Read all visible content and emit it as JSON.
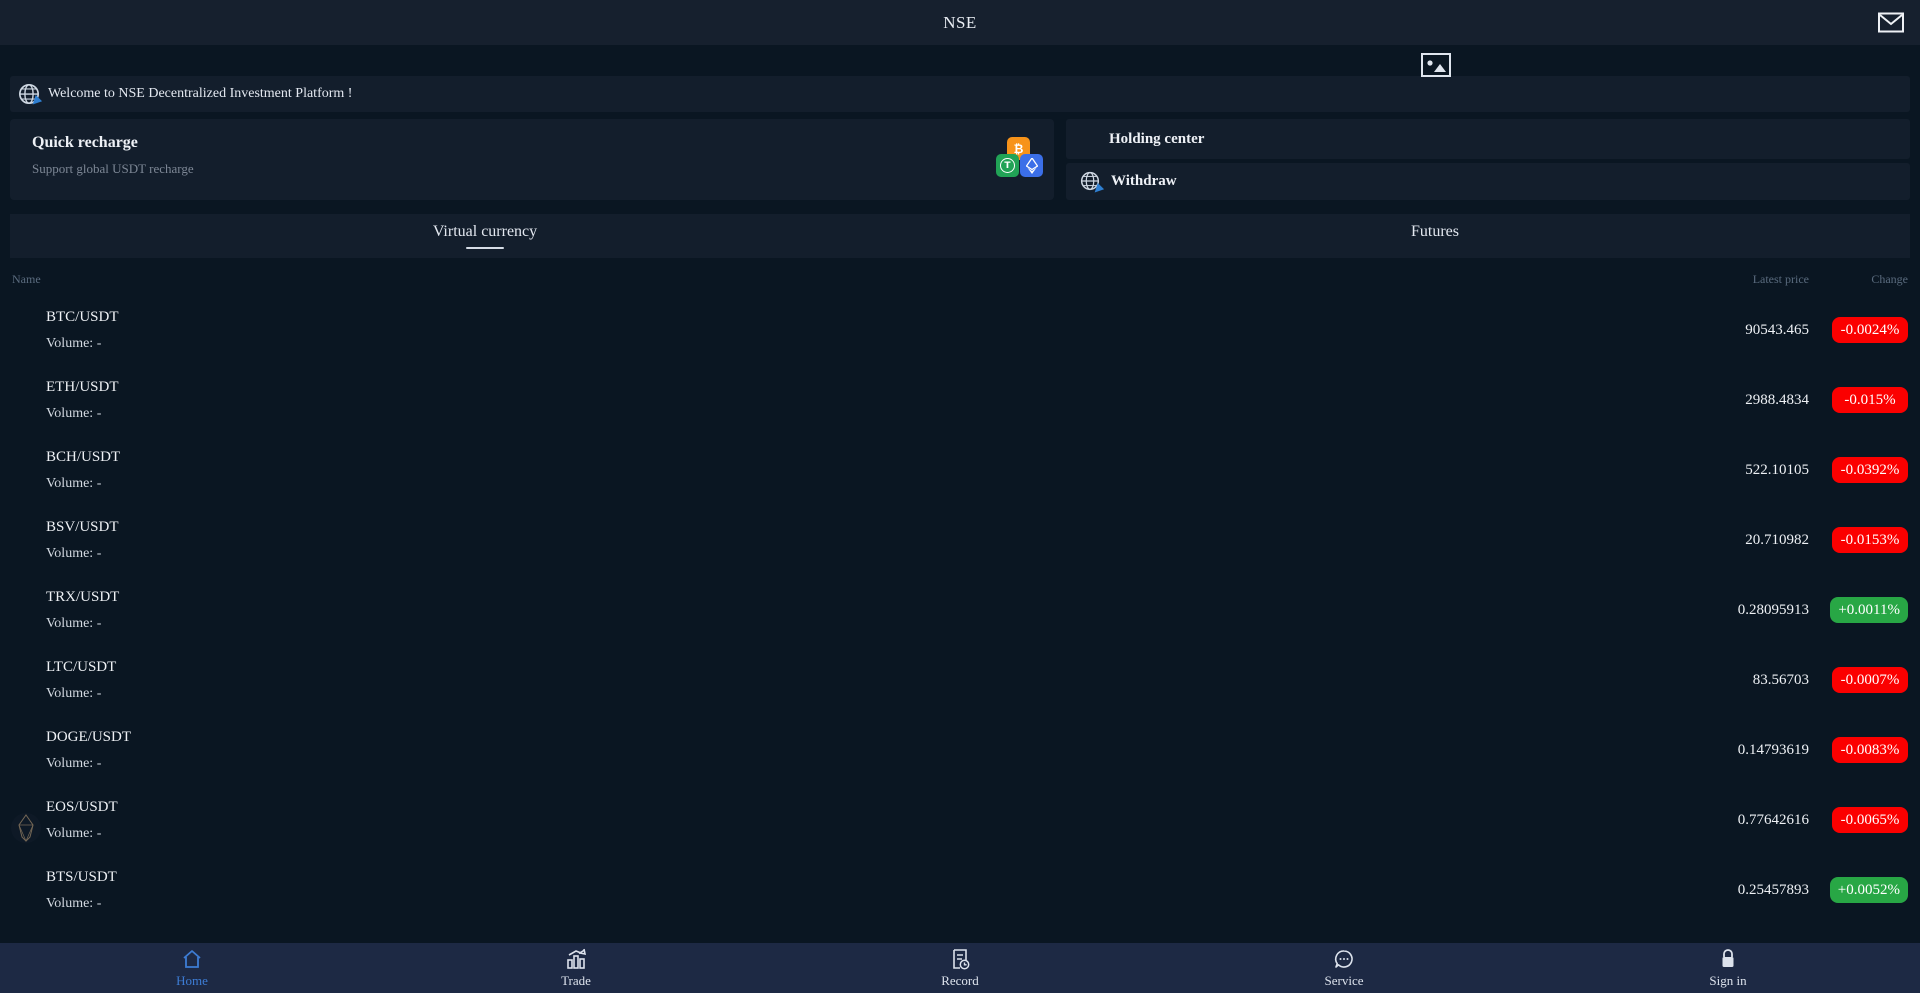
{
  "topbar": {
    "title": "NSE"
  },
  "notice": {
    "text": "Welcome to NSE Decentralized Investment Platform !"
  },
  "quick_recharge": {
    "title": "Quick recharge",
    "subtitle": "Support global USDT recharge",
    "coin_icons": [
      "bitcoin-icon",
      "tether-icon",
      "ethereum-icon"
    ]
  },
  "actions": {
    "holding_label": "Holding center",
    "withdraw_label": "Withdraw"
  },
  "tabs": [
    {
      "label": "Virtual currency",
      "active": true
    },
    {
      "label": "Futures",
      "active": false
    }
  ],
  "market": {
    "headers": {
      "name": "Name",
      "price": "Latest price",
      "change": "Change"
    },
    "rows": [
      {
        "symbol": "BTC/USDT",
        "volume": "Volume: -",
        "price": "90543.465",
        "change": "-0.0024%",
        "direction": "down"
      },
      {
        "symbol": "ETH/USDT",
        "volume": "Volume: -",
        "price": "2988.4834",
        "change": "-0.015%",
        "direction": "down"
      },
      {
        "symbol": "BCH/USDT",
        "volume": "Volume: -",
        "price": "522.10105",
        "change": "-0.0392%",
        "direction": "down"
      },
      {
        "symbol": "BSV/USDT",
        "volume": "Volume: -",
        "price": "20.710982",
        "change": "-0.0153%",
        "direction": "down"
      },
      {
        "symbol": "TRX/USDT",
        "volume": "Volume: -",
        "price": "0.28095913",
        "change": "+0.0011%",
        "direction": "up"
      },
      {
        "symbol": "LTC/USDT",
        "volume": "Volume: -",
        "price": "83.56703",
        "change": "-0.0007%",
        "direction": "down"
      },
      {
        "symbol": "DOGE/USDT",
        "volume": "Volume: -",
        "price": "0.14793619",
        "change": "-0.0083%",
        "direction": "down"
      },
      {
        "symbol": "EOS/USDT",
        "volume": "Volume: -",
        "price": "0.77642616",
        "change": "-0.0065%",
        "direction": "down"
      },
      {
        "symbol": "BTS/USDT",
        "volume": "Volume: -",
        "price": "0.25457893",
        "change": "+0.0052%",
        "direction": "up"
      }
    ]
  },
  "nav": {
    "items": [
      {
        "label": "Home",
        "icon": "home-icon",
        "active": true
      },
      {
        "label": "Trade",
        "icon": "trade-icon",
        "active": false
      },
      {
        "label": "Record",
        "icon": "record-icon",
        "active": false
      },
      {
        "label": "Service",
        "icon": "service-icon",
        "active": false
      },
      {
        "label": "Sign in",
        "icon": "lock-icon",
        "active": false
      }
    ]
  },
  "colors": {
    "change_down": "#fb0000",
    "change_up": "#28a745",
    "active_nav": "#3d7cd4",
    "bitcoin_orange": "#f7931a",
    "tether_green": "#21a356",
    "ethereum_blue": "#3b6fe8"
  }
}
